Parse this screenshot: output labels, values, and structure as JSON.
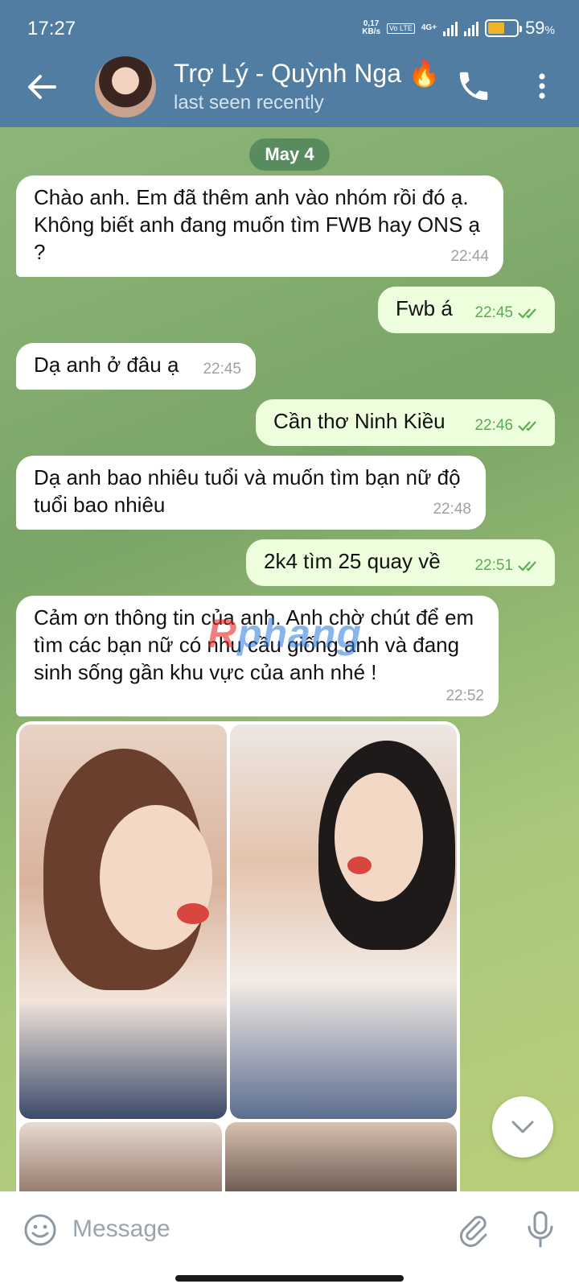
{
  "status_bar": {
    "time": "17:27",
    "net_speed_top": "0,17",
    "net_speed_bottom": "KB/s",
    "volte": "Vo LTE",
    "network": "4G+",
    "battery": "59",
    "battery_unit": "%",
    "battery_level": 0.59
  },
  "header": {
    "title": "Trợ Lý - Quỳnh Nga 🔥",
    "subtitle": "last seen recently"
  },
  "chat": {
    "date_chip": "May 4",
    "messages": [
      {
        "dir": "in",
        "text": "Chào anh. Em đã thêm anh vào nhóm rồi đó ạ. Không biết anh đang muốn tìm FWB hay ONS ạ ?",
        "time": "22:44"
      },
      {
        "dir": "out",
        "text": "Fwb á",
        "time": "22:45"
      },
      {
        "dir": "in",
        "text": "Dạ anh ở đâu ạ",
        "time": "22:45"
      },
      {
        "dir": "out",
        "text": "Cần thơ Ninh Kiều",
        "time": "22:46"
      },
      {
        "dir": "in",
        "text": "Dạ anh bao nhiêu tuổi và muốn tìm bạn nữ độ tuổi bao nhiêu",
        "time": "22:48"
      },
      {
        "dir": "out",
        "text": "2k4 tìm 25 quay về",
        "time": "22:51"
      },
      {
        "dir": "in",
        "text": "Cảm ơn thông tin của anh. Anh chờ chút để em tìm các bạn nữ có nhu cầu giống anh và đang sinh sống gần khu vực của anh nhé !",
        "time": "22:52"
      }
    ],
    "watermark": "Rphang"
  },
  "input": {
    "placeholder": "Message"
  },
  "colors": {
    "header_bg": "#517da2",
    "outgoing_bubble": "#eeffde",
    "incoming_bubble": "#ffffff",
    "read_ticks": "#5aab53"
  }
}
